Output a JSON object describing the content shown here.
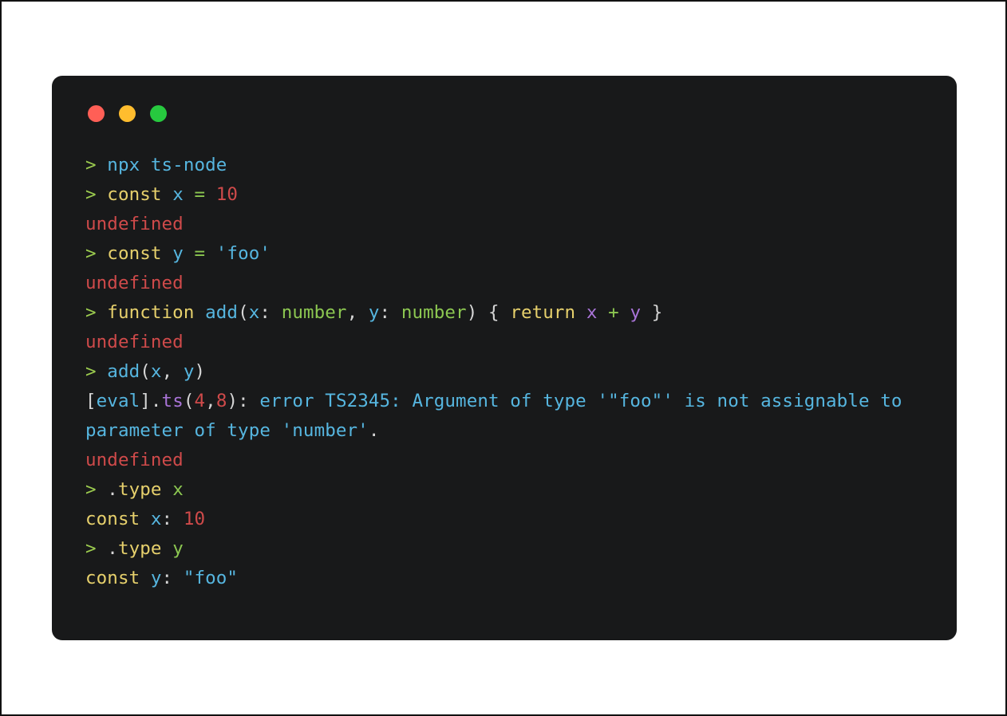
{
  "window": {
    "kind": "terminal-window",
    "background": "#18191A",
    "page_background": "#FFFFFF",
    "controls": [
      {
        "name": "close",
        "color": "#FF5F56"
      },
      {
        "name": "minimize",
        "color": "#FFBD2E"
      },
      {
        "name": "maximize",
        "color": "#27C93F"
      }
    ]
  },
  "palette": {
    "prompt_green": "#9CCC4F",
    "cyan": "#56B6E0",
    "yellow": "#E6D06C",
    "green": "#8CC751",
    "red": "#CF4A4A",
    "violet": "#A974D8",
    "white": "#D6D6D6"
  },
  "console": {
    "lines": [
      {
        "id": "line-1",
        "kind": "command",
        "text": "> npx ts-node",
        "tokens": [
          {
            "t": "> ",
            "c": "prompt"
          },
          {
            "t": "npx ts-node",
            "c": "cyan"
          }
        ]
      },
      {
        "id": "line-2",
        "kind": "command",
        "text": "> const x = 10",
        "tokens": [
          {
            "t": "> ",
            "c": "prompt"
          },
          {
            "t": "const ",
            "c": "yellow"
          },
          {
            "t": "x ",
            "c": "cyan"
          },
          {
            "t": "= ",
            "c": "green"
          },
          {
            "t": "10",
            "c": "red"
          }
        ]
      },
      {
        "id": "line-3",
        "kind": "output",
        "text": "undefined",
        "tokens": [
          {
            "t": "undefined",
            "c": "red"
          }
        ]
      },
      {
        "id": "line-4",
        "kind": "command",
        "text": "> const y = 'foo'",
        "tokens": [
          {
            "t": "> ",
            "c": "prompt"
          },
          {
            "t": "const ",
            "c": "yellow"
          },
          {
            "t": "y ",
            "c": "cyan"
          },
          {
            "t": "= ",
            "c": "green"
          },
          {
            "t": "'foo'",
            "c": "cyan"
          }
        ]
      },
      {
        "id": "line-5",
        "kind": "output",
        "text": "undefined",
        "tokens": [
          {
            "t": "undefined",
            "c": "red"
          }
        ]
      },
      {
        "id": "line-6",
        "kind": "command",
        "text": "> function add(x: number, y: number) { return x + y }",
        "tokens": [
          {
            "t": "> ",
            "c": "prompt"
          },
          {
            "t": "function ",
            "c": "yellow"
          },
          {
            "t": "add",
            "c": "cyan"
          },
          {
            "t": "(",
            "c": "white"
          },
          {
            "t": "x",
            "c": "cyan"
          },
          {
            "t": ": ",
            "c": "white"
          },
          {
            "t": "number",
            "c": "green"
          },
          {
            "t": ", ",
            "c": "white"
          },
          {
            "t": "y",
            "c": "cyan"
          },
          {
            "t": ": ",
            "c": "white"
          },
          {
            "t": "number",
            "c": "green"
          },
          {
            "t": ") { ",
            "c": "white"
          },
          {
            "t": "return ",
            "c": "yellow"
          },
          {
            "t": "x ",
            "c": "violet"
          },
          {
            "t": "+ ",
            "c": "green"
          },
          {
            "t": "y",
            "c": "violet"
          },
          {
            "t": " }",
            "c": "white"
          }
        ]
      },
      {
        "id": "line-7",
        "kind": "output",
        "text": "undefined",
        "tokens": [
          {
            "t": "undefined",
            "c": "red"
          }
        ]
      },
      {
        "id": "line-8",
        "kind": "command",
        "text": "> add(x, y)",
        "tokens": [
          {
            "t": "> ",
            "c": "prompt"
          },
          {
            "t": "add",
            "c": "cyan"
          },
          {
            "t": "(",
            "c": "white"
          },
          {
            "t": "x",
            "c": "cyan"
          },
          {
            "t": ", ",
            "c": "white"
          },
          {
            "t": "y",
            "c": "cyan"
          },
          {
            "t": ")",
            "c": "white"
          }
        ]
      },
      {
        "id": "line-9",
        "kind": "error",
        "text": "[eval].ts(4,8): error TS2345: Argument of type '\"foo\"' is not assignable to parameter of type 'number'.",
        "tokens": [
          {
            "t": "[",
            "c": "white"
          },
          {
            "t": "eval",
            "c": "cyan"
          },
          {
            "t": "].",
            "c": "white"
          },
          {
            "t": "ts",
            "c": "violet"
          },
          {
            "t": "(",
            "c": "white"
          },
          {
            "t": "4",
            "c": "red"
          },
          {
            "t": ",",
            "c": "white"
          },
          {
            "t": "8",
            "c": "red"
          },
          {
            "t": "): ",
            "c": "white"
          },
          {
            "t": "error TS2345: Argument of type '\"foo\"' is not assignable to parameter of type 'number'",
            "c": "cyan"
          },
          {
            "t": ".",
            "c": "white"
          }
        ]
      },
      {
        "id": "line-10",
        "kind": "output",
        "text": "undefined",
        "tokens": [
          {
            "t": "undefined",
            "c": "red"
          }
        ]
      },
      {
        "id": "line-11",
        "kind": "command",
        "text": "> .type x",
        "tokens": [
          {
            "t": "> ",
            "c": "prompt"
          },
          {
            "t": ".",
            "c": "white"
          },
          {
            "t": "type ",
            "c": "yellow"
          },
          {
            "t": "x",
            "c": "green"
          }
        ]
      },
      {
        "id": "line-12",
        "kind": "output",
        "text": "const x: 10",
        "tokens": [
          {
            "t": "const ",
            "c": "yellow"
          },
          {
            "t": "x",
            "c": "cyan"
          },
          {
            "t": ": ",
            "c": "white"
          },
          {
            "t": "10",
            "c": "red"
          }
        ]
      },
      {
        "id": "line-13",
        "kind": "command",
        "text": "> .type y",
        "tokens": [
          {
            "t": "> ",
            "c": "prompt"
          },
          {
            "t": ".",
            "c": "white"
          },
          {
            "t": "type ",
            "c": "yellow"
          },
          {
            "t": "y",
            "c": "green"
          }
        ]
      },
      {
        "id": "line-14",
        "kind": "output",
        "text": "const y: \"foo\"",
        "tokens": [
          {
            "t": "const ",
            "c": "yellow"
          },
          {
            "t": "y",
            "c": "cyan"
          },
          {
            "t": ": ",
            "c": "white"
          },
          {
            "t": "\"foo\"",
            "c": "cyan"
          }
        ]
      }
    ]
  }
}
